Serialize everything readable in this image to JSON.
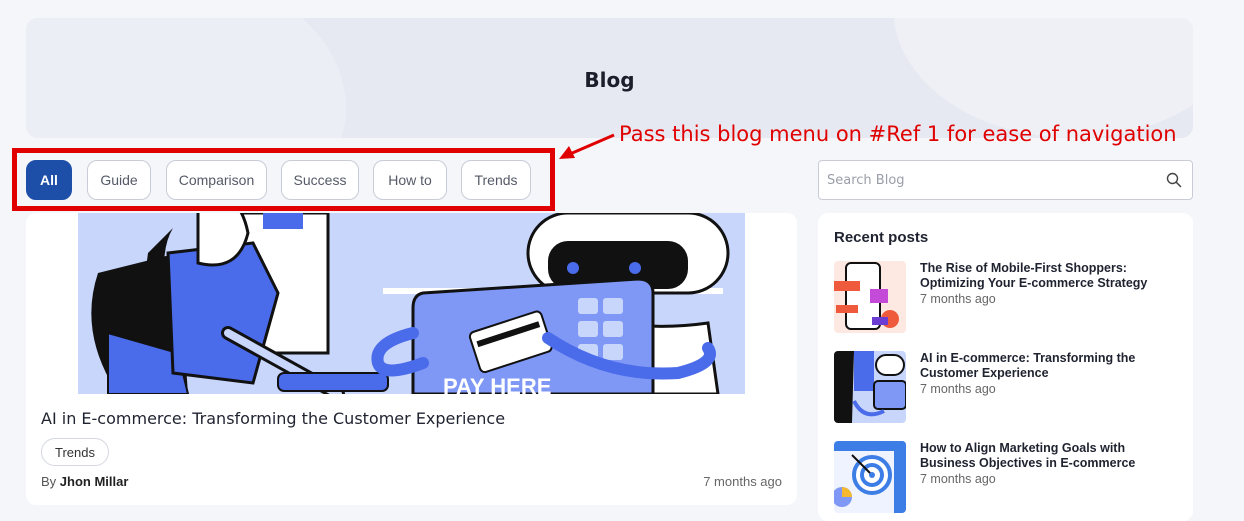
{
  "hero": {
    "title": "Blog"
  },
  "annotation": {
    "text": "Pass this blog menu on #Ref 1 for ease of navigation",
    "color": "#e00000"
  },
  "tabs": [
    {
      "label": "All",
      "active": true
    },
    {
      "label": "Guide"
    },
    {
      "label": "Comparison"
    },
    {
      "label": "Success"
    },
    {
      "label": "How to"
    },
    {
      "label": "Trends"
    }
  ],
  "search": {
    "placeholder": "Search Blog",
    "icon": "search-icon"
  },
  "featured": {
    "title": "AI in E-commerce: Transforming the Customer Experience",
    "tag": "Trends",
    "author_prefix": "By",
    "author": "Jhon Millar",
    "time": "7 months ago",
    "image_text": "PAY HERE"
  },
  "recent": {
    "heading": "Recent posts",
    "posts": [
      {
        "title": "The Rise of Mobile-First Shoppers: Optimizing Your E-commerce Strategy",
        "time": "7 months ago"
      },
      {
        "title": "AI in E-commerce: Transforming the Customer Experience",
        "time": "7 months ago"
      },
      {
        "title": "How to Align Marketing Goals with Business Objectives in E-commerce",
        "time": "7 months ago"
      }
    ]
  },
  "colors": {
    "accent": "#1d4fa8",
    "illustration": "#4a6bea",
    "background": "#f5f6fa"
  }
}
